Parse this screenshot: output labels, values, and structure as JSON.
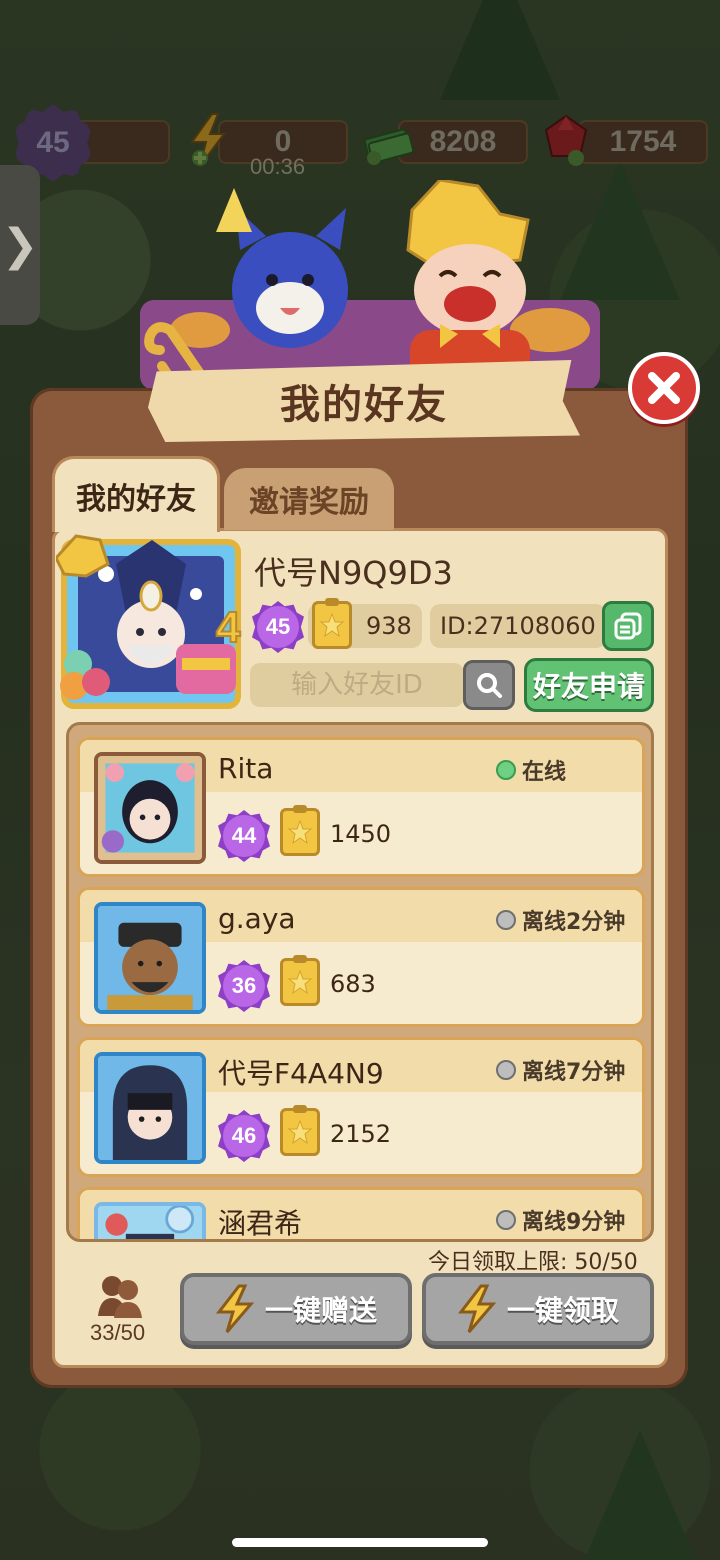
{
  "resources": {
    "level": "45",
    "energy": "0",
    "energy_timer": "00:36",
    "cash": "8208",
    "gems": "1754"
  },
  "side_tab": {
    "glyph": "❯"
  },
  "dialog": {
    "title": "我的好友",
    "tabs": [
      {
        "label": "我的好友",
        "active": true
      },
      {
        "label": "邀请奖励",
        "active": false
      }
    ]
  },
  "profile": {
    "name": "代号N9Q9D3",
    "level": "45",
    "score": "938",
    "id": "ID:27108060",
    "birthday_number": "4"
  },
  "search": {
    "placeholder": "输入好友ID",
    "apply_label": "好友申请"
  },
  "friends": [
    {
      "name": "Rita",
      "level": "44",
      "score": "1450",
      "status": "在线",
      "online": true
    },
    {
      "name": "g.aya",
      "level": "36",
      "score": "683",
      "status": "离线2分钟",
      "online": false
    },
    {
      "name": "代号F4A4N9",
      "level": "46",
      "score": "2152",
      "status": "离线7分钟",
      "online": false
    },
    {
      "name": "涵君希",
      "level": "",
      "score": "",
      "status": "离线9分钟",
      "online": false
    }
  ],
  "footer": {
    "daily_limit": "今日领取上限: 50/50",
    "friend_count": "33/50",
    "send_all_label": "一键赠送",
    "claim_all_label": "一键领取"
  },
  "colors": {
    "panel": "#8b5a3c",
    "panel_inner": "#f1e2bd",
    "close": "#d93a36",
    "green_button": "#62c274",
    "disabled_button": "#a5a5a5",
    "level_purple": "#8e3fc8"
  }
}
